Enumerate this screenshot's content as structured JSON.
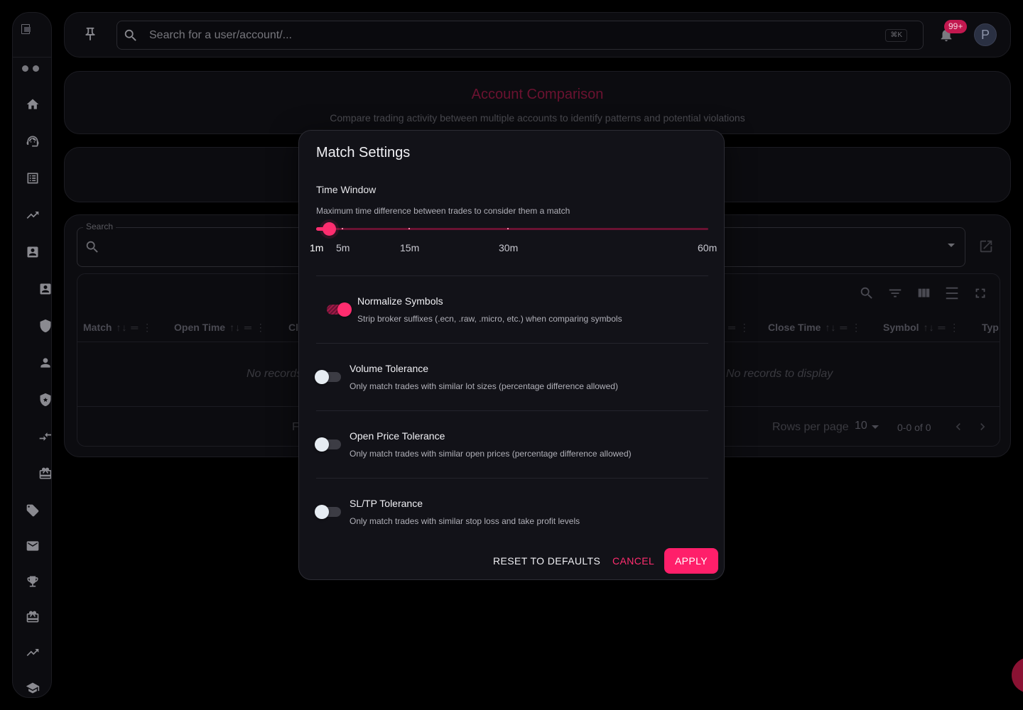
{
  "sidebar": {
    "icons": [
      "home-icon",
      "support-agent-icon",
      "list-alt-icon",
      "trending-up-icon",
      "account-box-icon",
      "contact-icon",
      "shield-icon",
      "person-icon",
      "verified-shield-icon",
      "compare-arrows-icon",
      "ticket-icon",
      "tag-icon",
      "mail-icon",
      "trophy-icon",
      "ticket-icon",
      "trending-up-icon",
      "school-icon"
    ]
  },
  "topbar": {
    "search_placeholder": "Search for a user/account/...",
    "shortcut": "⌘K",
    "notification_count": "99+",
    "avatar_initial": "P"
  },
  "page": {
    "title": "Account Comparison",
    "subtitle": "Compare trading activity between multiple accounts to identify patterns and potential violations"
  },
  "table": {
    "search_label": "Search",
    "columns": [
      "Match",
      "Open Time",
      "Cl",
      "Close Time",
      "Symbol",
      "Typ"
    ],
    "empty_text_left": "No records",
    "empty_text_right": "No records to display",
    "footer_left": "F",
    "rows_per_page_label": "Rows per page",
    "rows_per_page": "10",
    "page_info": "0-0 of 0"
  },
  "modal": {
    "title": "Match Settings",
    "time_window": {
      "label": "Time Window",
      "description": "Maximum time difference between trades to consider them a match",
      "marks": [
        "1m",
        "5m",
        "15m",
        "30m",
        "60m"
      ],
      "selected": "1m",
      "value_minutes": 1,
      "min_minutes": 1,
      "max_minutes": 60
    },
    "options": [
      {
        "title": "Normalize Symbols",
        "description": "Strip broker suffixes (.ecn, .raw, .micro, etc.) when comparing symbols",
        "enabled": true
      },
      {
        "title": "Volume Tolerance",
        "description": "Only match trades with similar lot sizes (percentage difference allowed)",
        "enabled": false
      },
      {
        "title": "Open Price Tolerance",
        "description": "Only match trades with similar open prices (percentage difference allowed)",
        "enabled": false
      },
      {
        "title": "SL/TP Tolerance",
        "description": "Only match trades with similar stop loss and take profit levels",
        "enabled": false
      }
    ],
    "buttons": {
      "reset": "RESET TO DEFAULTS",
      "cancel": "CANCEL",
      "apply": "APPLY"
    }
  },
  "colors": {
    "accent": "#ff2d6f",
    "background": "#000000",
    "panel": "#121218"
  }
}
